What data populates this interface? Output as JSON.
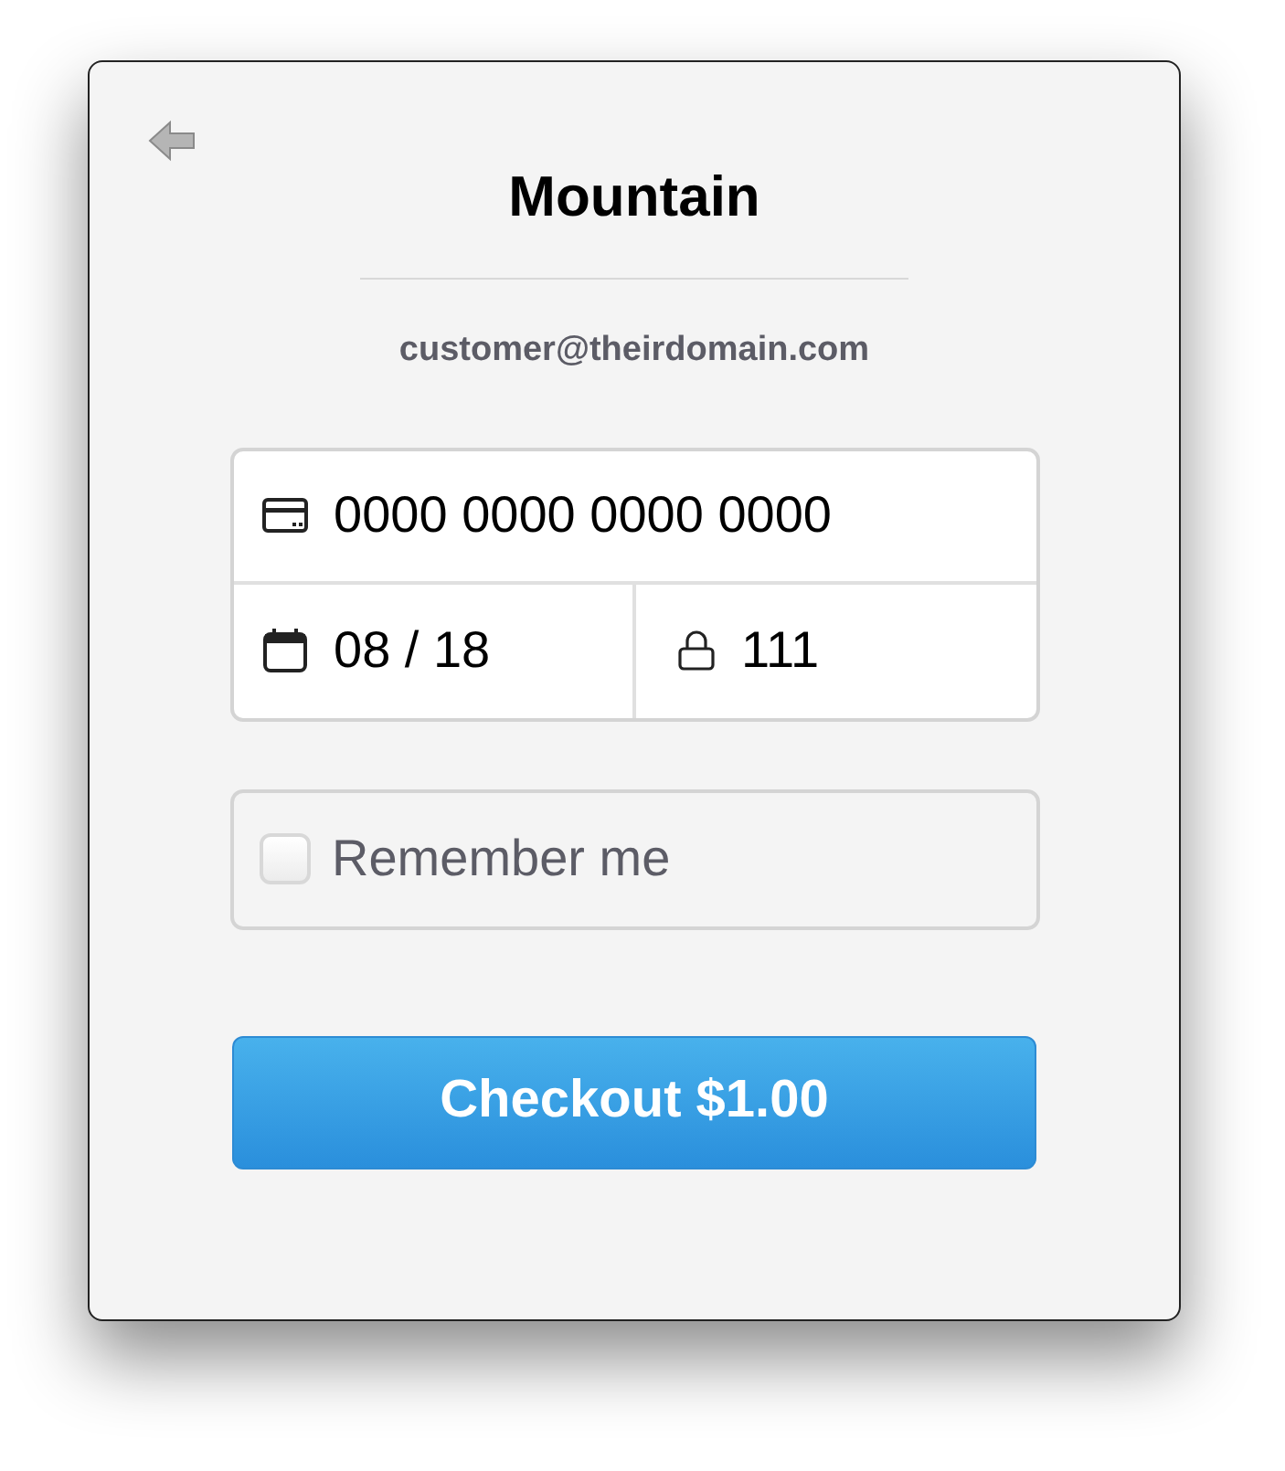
{
  "title": "Mountain",
  "email": "customer@theirdomain.com",
  "card_number": {
    "value": "0000 0000 0000 0000"
  },
  "expiry": {
    "value": "08 / 18"
  },
  "cvc": {
    "value": "111"
  },
  "remember_me": {
    "label": "Remember me",
    "checked": false
  },
  "checkout_button": {
    "label": "Checkout $1.00"
  }
}
